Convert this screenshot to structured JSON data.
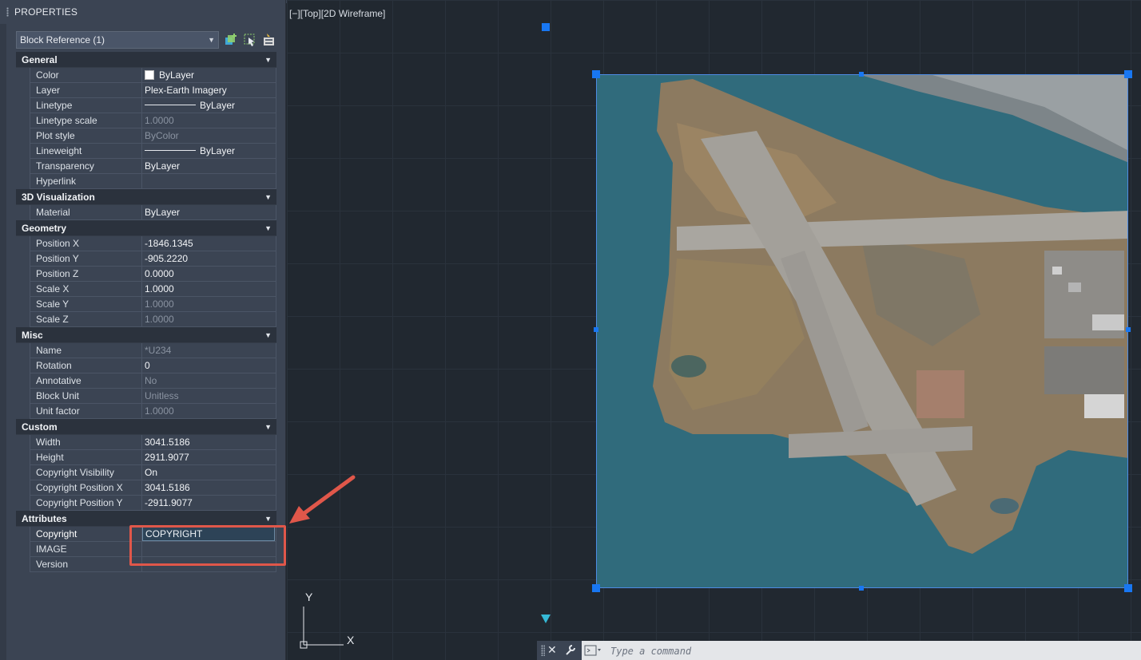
{
  "palette": {
    "title": "PROPERTIES",
    "selection": "Block Reference (1)",
    "icons": [
      "quick-select-add-icon",
      "select-objects-icon",
      "toggle-pickadd-icon"
    ]
  },
  "sections": [
    {
      "title": "General",
      "rows": [
        {
          "name": "Color",
          "value": "ByLayer",
          "kind": "swatch"
        },
        {
          "name": "Layer",
          "value": "Plex-Earth Imagery"
        },
        {
          "name": "Linetype",
          "value": "ByLayer",
          "kind": "line"
        },
        {
          "name": "Linetype scale",
          "value": "1.0000",
          "dim": true
        },
        {
          "name": "Plot style",
          "value": "ByColor",
          "dim": true
        },
        {
          "name": "Lineweight",
          "value": "ByLayer",
          "kind": "line"
        },
        {
          "name": "Transparency",
          "value": "ByLayer"
        },
        {
          "name": "Hyperlink",
          "value": ""
        }
      ]
    },
    {
      "title": "3D Visualization",
      "rows": [
        {
          "name": "Material",
          "value": "ByLayer"
        }
      ]
    },
    {
      "title": "Geometry",
      "rows": [
        {
          "name": "Position X",
          "value": "-1846.1345"
        },
        {
          "name": "Position Y",
          "value": "-905.2220"
        },
        {
          "name": "Position Z",
          "value": "0.0000"
        },
        {
          "name": "Scale X",
          "value": "1.0000"
        },
        {
          "name": "Scale Y",
          "value": "1.0000",
          "dim": true
        },
        {
          "name": "Scale Z",
          "value": "1.0000",
          "dim": true
        }
      ]
    },
    {
      "title": "Misc",
      "rows": [
        {
          "name": "Name",
          "value": "*U234",
          "dim": true
        },
        {
          "name": "Rotation",
          "value": "0"
        },
        {
          "name": "Annotative",
          "value": "No",
          "dim": true
        },
        {
          "name": "Block Unit",
          "value": "Unitless",
          "dim": true
        },
        {
          "name": "Unit factor",
          "value": "1.0000",
          "dim": true
        }
      ]
    },
    {
      "title": "Custom",
      "rows": [
        {
          "name": "Width",
          "value": "3041.5186"
        },
        {
          "name": "Height",
          "value": "2911.9077"
        },
        {
          "name": "Copyright Visibility",
          "value": "On"
        },
        {
          "name": "Copyright Position X",
          "value": "3041.5186"
        },
        {
          "name": "Copyright Position Y",
          "value": "-2911.9077"
        }
      ]
    },
    {
      "title": "Attributes",
      "rows": [
        {
          "name": "Copyright",
          "value": "COPYRIGHT",
          "kind": "edit"
        },
        {
          "name": "IMAGE",
          "value": ""
        },
        {
          "name": "Version",
          "value": ""
        }
      ]
    }
  ],
  "viewport": {
    "label": "[−][Top][2D Wireframe]",
    "ucs_x": "X",
    "ucs_y": "Y"
  },
  "command": {
    "close": "✕",
    "placeholder": "Type a command"
  },
  "colors": {
    "accent": "#1877f2",
    "highlight": "#e0574a",
    "water": "#2f6a7b",
    "land": "#8a7760"
  }
}
